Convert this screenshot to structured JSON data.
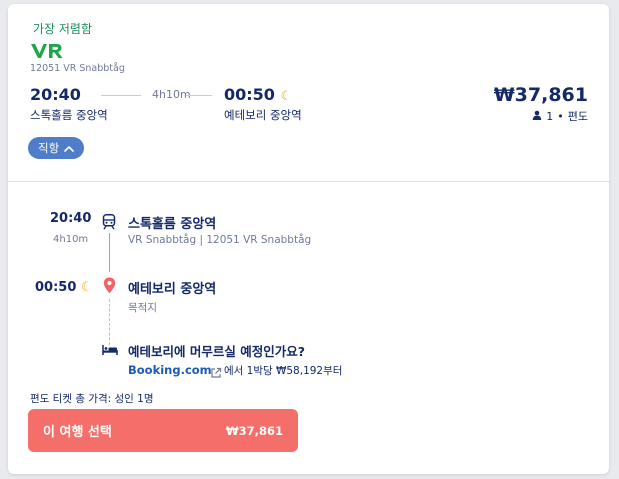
{
  "summary": {
    "badge": "가장 저렴함",
    "operator_logo": "VR",
    "train_id": "12051 VR Snabbtåg",
    "departure_time": "20:40",
    "arrival_time": "00:50",
    "duration": "4h10m",
    "departure_station": "스톡홀름 중앙역",
    "arrival_station": "예테보리 중앙역",
    "price": "₩37,861",
    "passengers": "1",
    "separator": "•",
    "ticket_type": "편도",
    "direct_label": "직항"
  },
  "details": {
    "departure_time": "20:40",
    "duration": "4h10m",
    "arrival_time": "00:50",
    "departure_station": "스톡홀름 중앙역",
    "train_info": "VR Snabbtåg | 12051 VR Snabbtåg",
    "arrival_station": "예테보리 중앙역",
    "destination_label": "목적지"
  },
  "hotel": {
    "question": "예테보리에 머무르실 예정인가요?",
    "provider": "Booking.com",
    "offer": "에서 1박당 ₩58,192부터"
  },
  "footer": {
    "total_label": "편도 티켓 총 가격: 성인 1명",
    "select_label": "이 여행 선택",
    "select_price": "₩37,861"
  },
  "colors": {
    "primary_text": "#132968",
    "accent_green": "#1a8f5a",
    "cta": "#f56f6a",
    "direct_badge": "#4f7dc9",
    "moon": "#e8a317",
    "booking_blue": "#1b5bb5"
  },
  "icons": [
    "vr-logo-icon",
    "moon-icon",
    "person-icon",
    "chevron-up-icon",
    "train-icon",
    "location-pin-icon",
    "bed-icon",
    "external-link-icon"
  ]
}
